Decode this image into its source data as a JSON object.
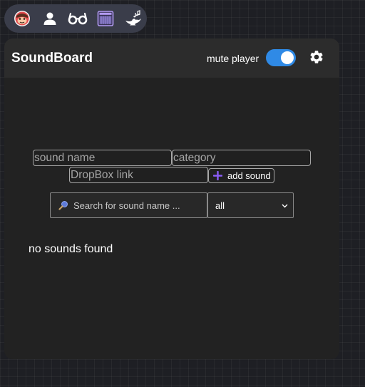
{
  "toolbar": {
    "items": [
      {
        "icon": "monkey-face-icon"
      },
      {
        "icon": "user-icon"
      },
      {
        "icon": "glasses-icon"
      },
      {
        "icon": "amplifier-icon"
      },
      {
        "icon": "genie-lamp-icon"
      }
    ]
  },
  "panel": {
    "title": "SoundBoard",
    "mute_label": "mute player",
    "mute_on": true
  },
  "form": {
    "sound_name_placeholder": "sound name",
    "category_placeholder": "category",
    "dropbox_placeholder": "DropBox link",
    "add_sound_label": "add sound"
  },
  "filter": {
    "search_placeholder": "Search for sound name ...",
    "category_selected": "all"
  },
  "list": {
    "empty_message": "no sounds found"
  },
  "colors": {
    "accent": "#2f8ae6",
    "plus": "#8a5cf6"
  }
}
